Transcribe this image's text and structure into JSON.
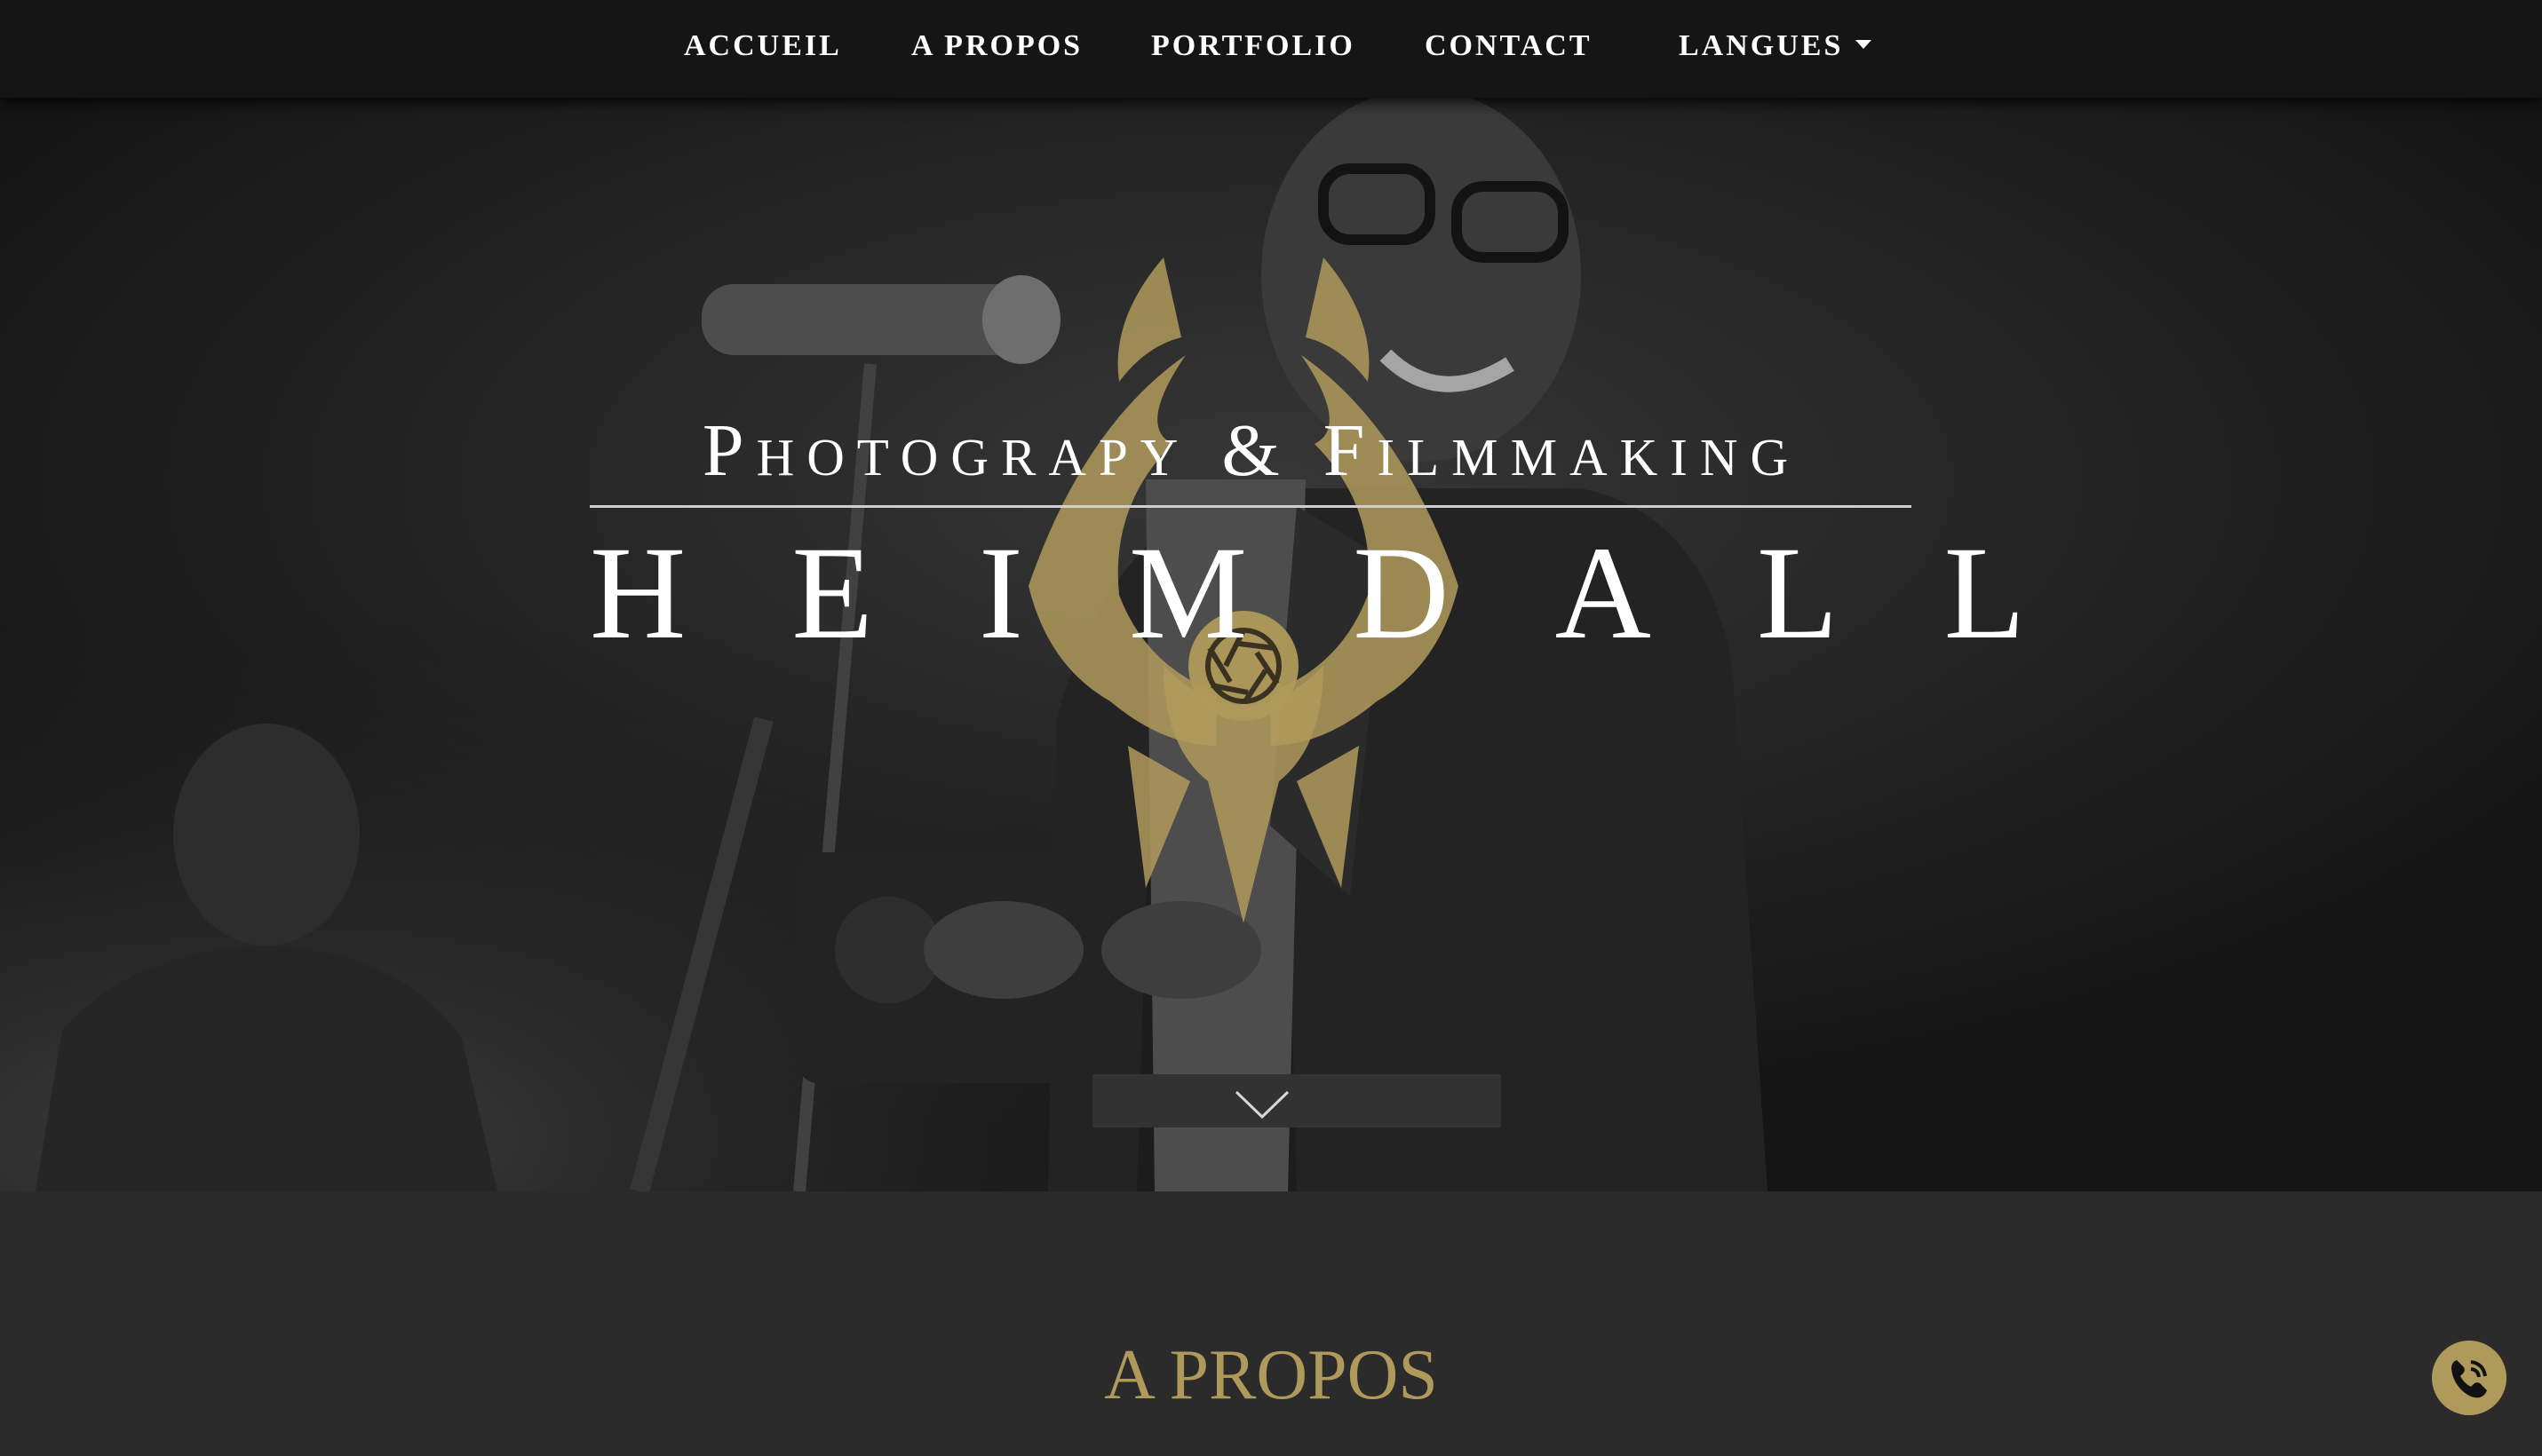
{
  "nav": {
    "items": [
      {
        "label": "ACCUEIL"
      },
      {
        "label": "A PROPOS"
      },
      {
        "label": "PORTFOLIO"
      },
      {
        "label": "CONTACT"
      },
      {
        "label": "LANGUES"
      }
    ],
    "dropdown_icon": "caret-down-icon"
  },
  "hero": {
    "tagline": "Photograpy & Filmmaking",
    "brand": "HEIMDALL",
    "emblem_icon": "winged-aperture-emblem",
    "scroll_icon": "chevron-down-icon"
  },
  "about": {
    "title": "A PROPOS"
  },
  "fab": {
    "icon": "phone-icon"
  },
  "colors": {
    "accent_gold": "#b09a5b",
    "nav_bg": "#151515",
    "section_bg": "#2b2b2b",
    "text": "#ffffff"
  }
}
